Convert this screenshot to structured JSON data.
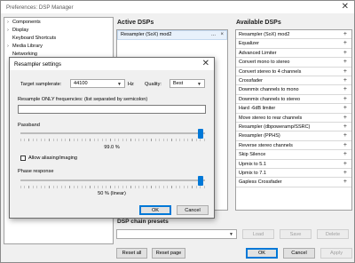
{
  "window": {
    "title": "Preferences: DSP Manager",
    "close": "✕"
  },
  "tree": {
    "items": [
      {
        "label": "Components",
        "arrow": "›"
      },
      {
        "label": "Display",
        "arrow": "›"
      },
      {
        "label": "Keyboard Shortcuts",
        "arrow": ""
      },
      {
        "label": "Media Library",
        "arrow": "›"
      },
      {
        "label": "Networking",
        "arrow": ""
      }
    ]
  },
  "active": {
    "header": "Active DSPs",
    "items": [
      {
        "label": "Resampler (SoX) mod2",
        "actions": "...",
        "remove": "×"
      }
    ]
  },
  "available": {
    "header": "Available DSPs",
    "plus": "+",
    "items": [
      "Resampler (SoX) mod2",
      "Equalizer",
      "Advanced Limiter",
      "Convert mono to stereo",
      "Convert stereo to 4 channels",
      "Crossfader",
      "Downmix channels to mono",
      "Downmix channels to stereo",
      "Hard -6dB limiter",
      "Move stereo to rear channels",
      "Resampler (dbpoweramp/SSRC)",
      "Resampler (PPHS)",
      "Reverse stereo channels",
      "Skip Silence",
      "Upmix to 5.1",
      "Upmix to 7.1",
      "Gapless Crossfader"
    ]
  },
  "presets": {
    "header": "DSP chain presets",
    "load": "Load",
    "save": "Save",
    "delete": "Delete"
  },
  "footer": {
    "reset_all": "Reset all",
    "reset_page": "Reset page",
    "ok": "OK",
    "cancel": "Cancel",
    "apply": "Apply"
  },
  "dialog": {
    "title": "Resampler settings",
    "close": "✕",
    "samplerate_label": "Target samplerate:",
    "samplerate_value": "44100",
    "samplerate_unit": "Hz",
    "quality_label": "Quality:",
    "quality_value": "Best",
    "freq_label": "Resample ONLY frequencies: (list separated by semicolon)",
    "freq_value": "",
    "passband_label": "Passband",
    "passband_value": "99.0 %",
    "passband_level": 0.99,
    "aliasing_label": "Allow aliasing/imaging",
    "aliasing_checked": false,
    "phase_label": "Phase response",
    "phase_value": "50 % (linear)",
    "phase_level": 0.99,
    "ok": "OK",
    "cancel": "Cancel"
  },
  "colors": {
    "accent": "#0078d7",
    "selected_row": "#e8f1fb"
  }
}
